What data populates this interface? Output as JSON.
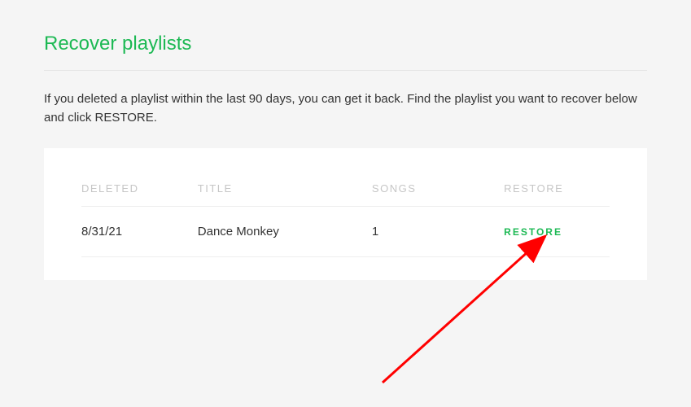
{
  "page": {
    "title": "Recover playlists",
    "description": "If you deleted a playlist within the last 90 days, you can get it back. Find the playlist you want to recover below and click RESTORE."
  },
  "table": {
    "headers": {
      "deleted": "DELETED",
      "title": "TITLE",
      "songs": "SONGS",
      "restore": "RESTORE"
    },
    "rows": [
      {
        "deleted": "8/31/21",
        "title": "Dance Monkey",
        "songs": "1",
        "restore_label": "RESTORE"
      }
    ]
  }
}
